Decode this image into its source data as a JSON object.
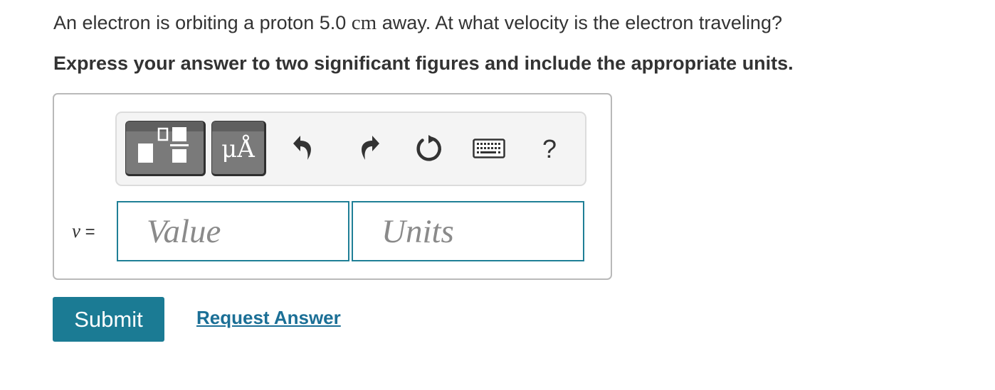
{
  "question": {
    "text_before": "An electron is orbiting a proton 5.0 ",
    "unit": "cm",
    "text_after": " away. At what velocity is the electron traveling?"
  },
  "instruction": "Express your answer to two significant figures and include the appropriate units.",
  "toolbar": {
    "units_symbol": "μÅ",
    "help_label": "?",
    "icons": [
      "templates-icon",
      "units-icon",
      "undo-icon",
      "redo-icon",
      "reset-icon",
      "keyboard-icon",
      "help-icon"
    ]
  },
  "answer": {
    "variable": "v",
    "equals": " =",
    "value_placeholder": "Value",
    "units_placeholder": "Units"
  },
  "actions": {
    "submit_label": "Submit",
    "request_answer_label": "Request Answer"
  },
  "colors": {
    "accent": "#1b7b94",
    "link": "#1b6f96",
    "toolbar_button": "#7a7a7a"
  }
}
